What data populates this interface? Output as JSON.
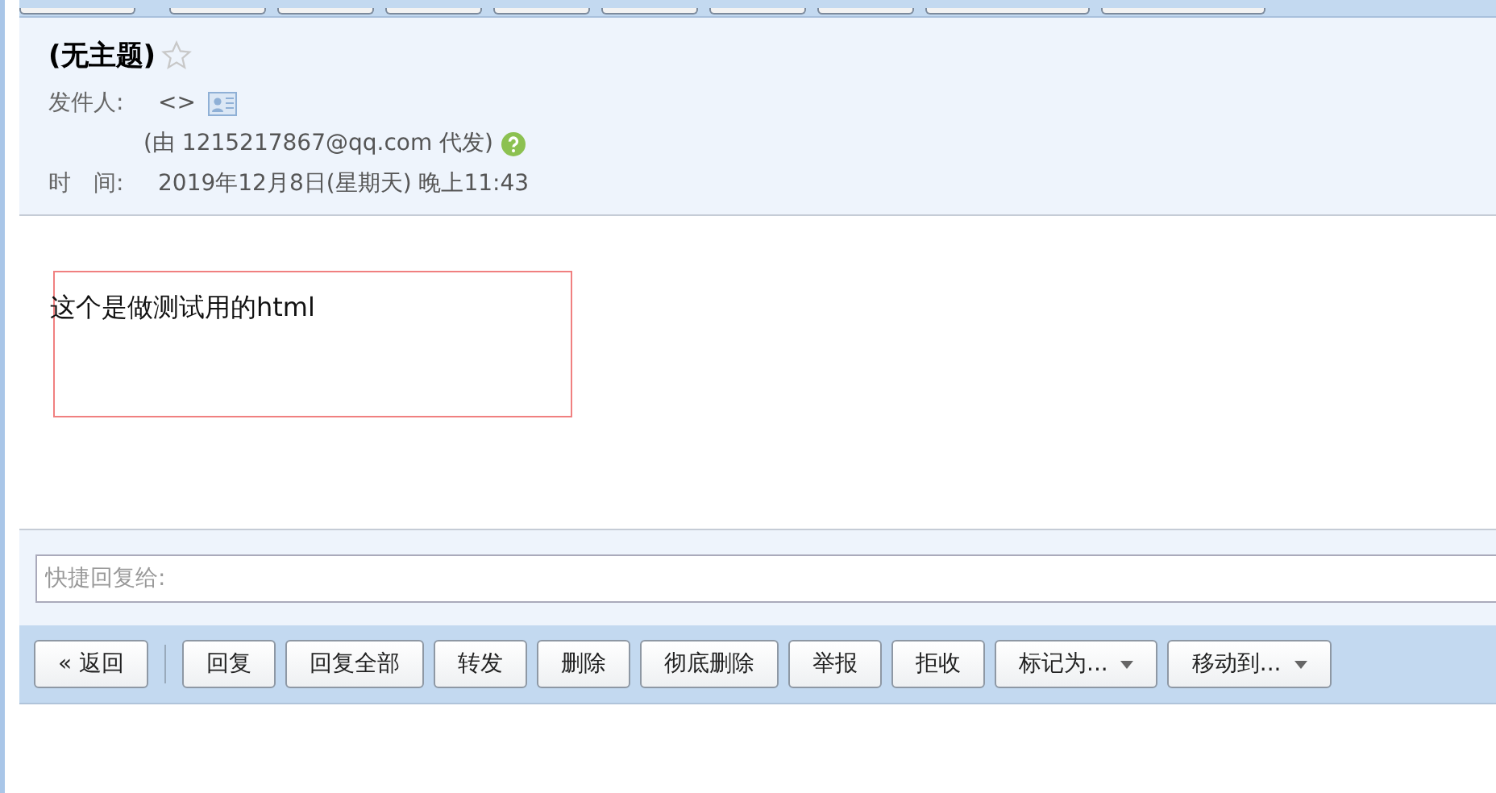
{
  "message": {
    "subject": "(无主题)",
    "starred": false,
    "sender_label": "发件人:",
    "sender": "<>",
    "on_behalf": "(由 1215217867@qq.com 代发)",
    "time_label": "时　间:",
    "time": "2019年12月8日(星期天) 晚上11:43"
  },
  "body": {
    "text": "这个是做测试用的html"
  },
  "quick_reply": {
    "placeholder": "快捷回复给:"
  },
  "toolbar": {
    "buttons": [
      {
        "label": "« 返回",
        "kind": "plain"
      },
      {
        "label": "回复",
        "kind": "plain"
      },
      {
        "label": "回复全部",
        "kind": "plain"
      },
      {
        "label": "转发",
        "kind": "plain"
      },
      {
        "label": "删除",
        "kind": "plain"
      },
      {
        "label": "彻底删除",
        "kind": "plain"
      },
      {
        "label": "举报",
        "kind": "plain"
      },
      {
        "label": "拒收",
        "kind": "plain"
      },
      {
        "label": "标记为...",
        "kind": "dropdown"
      },
      {
        "label": "移动到...",
        "kind": "dropdown"
      }
    ]
  }
}
